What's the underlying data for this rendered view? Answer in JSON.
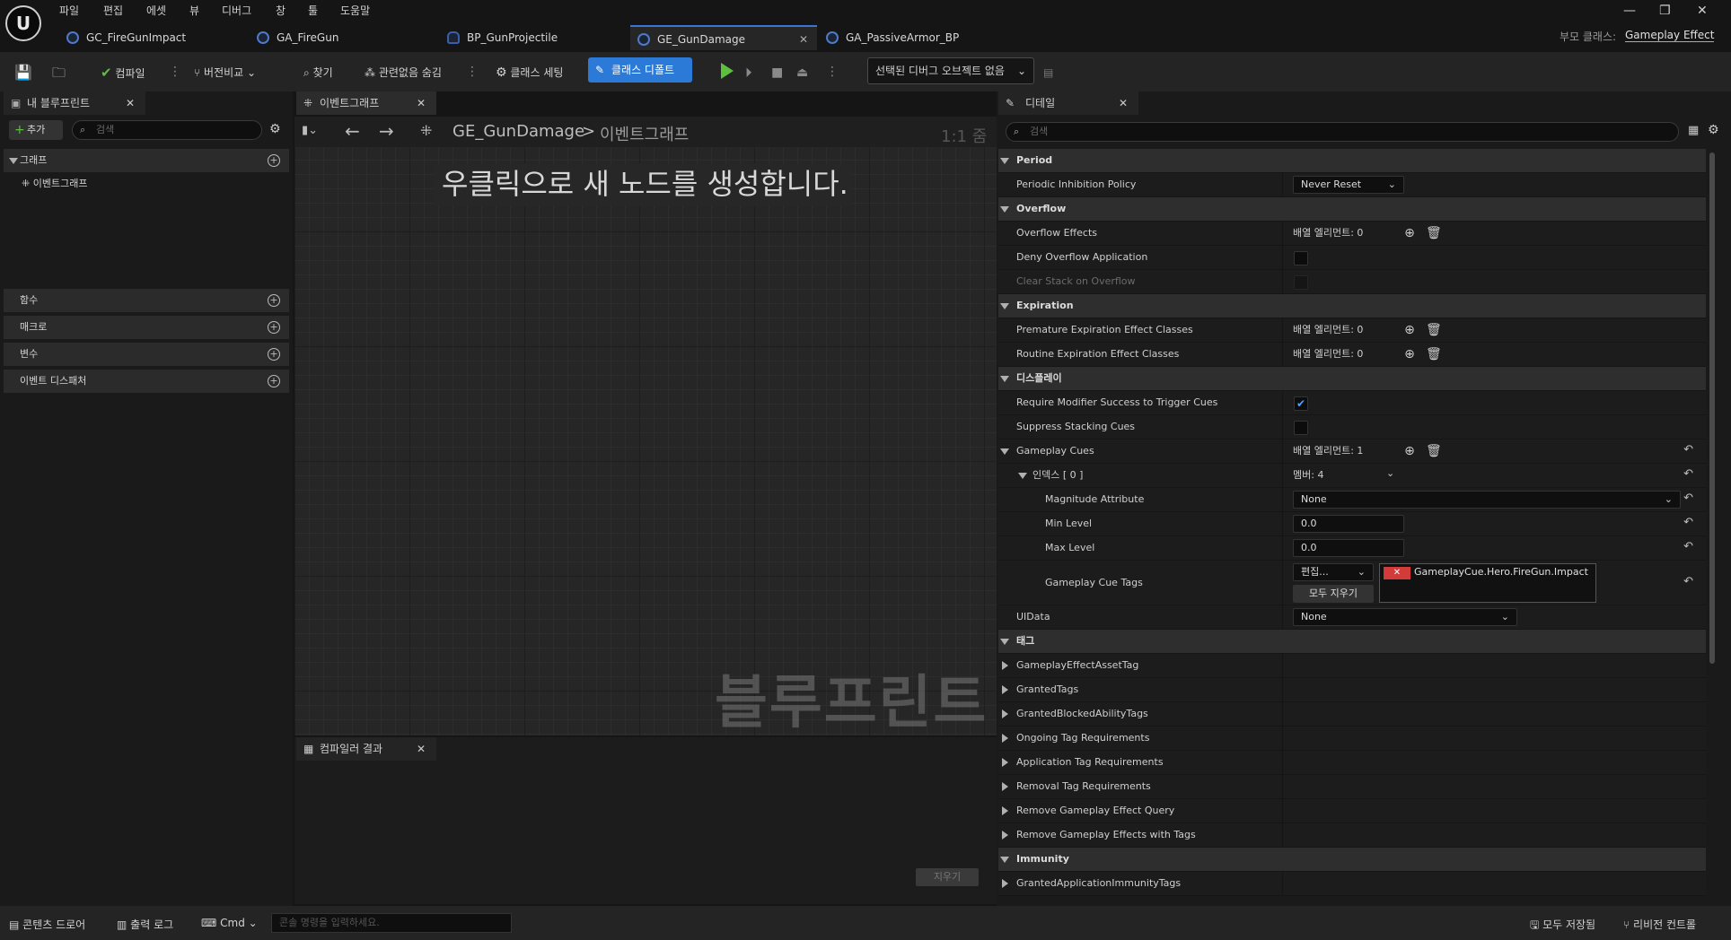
{
  "menu": [
    "파일",
    "편집",
    "에셋",
    "뷰",
    "디버그",
    "창",
    "툴",
    "도움말"
  ],
  "tabs": [
    "GC_FireGunImpact",
    "GA_FireGun",
    "BP_GunProjectile",
    "GE_GunDamage",
    "GA_PassiveArmor_BP"
  ],
  "tab_close": "✕",
  "parent_class": {
    "label": "부모 클래스:",
    "value": "Gameplay Effect"
  },
  "toolbar": {
    "compile": "컴파일",
    "diff": "버전비교",
    "find": "찾기",
    "hide_unrelated": "관련없음 숨김",
    "class_settings": "클래스 세팅",
    "class_defaults": "클래스 디폴트",
    "debug_object": "선택된 디버그 오브젝트 없음"
  },
  "left_panel": {
    "title": "내 블루프린트",
    "add": "추가",
    "search_placeholder": "검색",
    "sections": [
      "그래프",
      "함수",
      "매크로",
      "변수",
      "이벤트 디스패처"
    ],
    "graph_item": "이벤트그래프"
  },
  "graph": {
    "tab": "이벤트그래프",
    "breadcrumb_asset": "GE_GunDamage",
    "breadcrumb_sep": ">",
    "breadcrumb_graph": "이벤트그래프",
    "zoom": "1:1 줌",
    "hint": "우클릭으로 새 노드를 생성합니다.",
    "watermark": "블루프린트"
  },
  "compiler": {
    "title": "컴파일러 결과",
    "clear": "지우기"
  },
  "details": {
    "title": "디테일",
    "search_placeholder": "검색",
    "period": "Period",
    "periodic_inhibition": "Periodic Inhibition Policy",
    "never_reset": "Never Reset",
    "overflow": "Overflow",
    "overflow_effects": "Overflow Effects",
    "array_0": "배열 엘리먼트: 0",
    "deny_overflow": "Deny Overflow Application",
    "clear_stack": "Clear Stack on Overflow",
    "expiration": "Expiration",
    "premature": "Premature Expiration Effect Classes",
    "routine": "Routine Expiration Effect Classes",
    "display": "디스플레이",
    "require_modifier": "Require Modifier Success to Trigger Cues",
    "suppress_stacking": "Suppress Stacking Cues",
    "gameplay_cues": "Gameplay Cues",
    "array_1": "배열 엘리먼트: 1",
    "index0": "인덱스 [ 0 ]",
    "members": "멤버: 4",
    "magnitude_attr": "Magnitude Attribute",
    "none": "None",
    "min_level": "Min Level",
    "max_level": "Max Level",
    "level_value": "0.0",
    "cue_tags": "Gameplay Cue Tags",
    "edit": "편집...",
    "clear_all": "모두 지우기",
    "cue_tag_value": "GameplayCue.Hero.FireGun.Impact",
    "uidata": "UIData",
    "tags": "태그",
    "tag_rows": [
      "GameplayEffectAssetTag",
      "GrantedTags",
      "GrantedBlockedAbilityTags",
      "Ongoing Tag Requirements",
      "Application Tag Requirements",
      "Removal Tag Requirements",
      "Remove Gameplay Effect Query",
      "Remove Gameplay Effects with Tags"
    ],
    "immunity": "Immunity",
    "granted_immunity": "GrantedApplicationImmunityTags"
  },
  "bottom": {
    "content_drawer": "콘텐츠 드로어",
    "output_log": "출력 로그",
    "cmd": "Cmd",
    "cmd_placeholder": "콘솔 명령을 입력하세요.",
    "save_all": "모두 저장됨",
    "revision": "리비전 컨트롤"
  },
  "colors": {
    "accent": "#2c7ad8",
    "play": "#5cbf3e",
    "tag_x": "#d33a3a"
  }
}
